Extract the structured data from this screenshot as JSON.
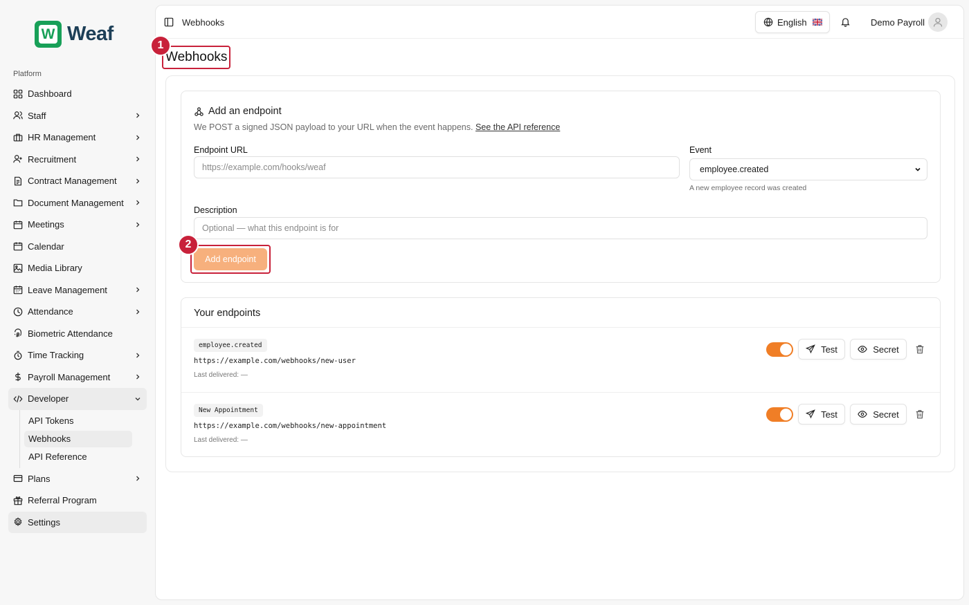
{
  "brand": {
    "name": "Weaf",
    "badge_letter": "W",
    "color": "#18a058"
  },
  "sidebar": {
    "section_label": "Platform",
    "items": [
      {
        "label": "Dashboard",
        "icon": "dashboard-icon",
        "chevron": false
      },
      {
        "label": "Staff",
        "icon": "users-icon",
        "chevron": true
      },
      {
        "label": "HR Management",
        "icon": "briefcase-icon",
        "chevron": true
      },
      {
        "label": "Recruitment",
        "icon": "user-plus-icon",
        "chevron": true
      },
      {
        "label": "Contract Management",
        "icon": "document-icon",
        "chevron": true
      },
      {
        "label": "Document Management",
        "icon": "folder-icon",
        "chevron": true
      },
      {
        "label": "Meetings",
        "icon": "calendar-icon",
        "chevron": true
      },
      {
        "label": "Calendar",
        "icon": "calendar-icon",
        "chevron": false
      },
      {
        "label": "Media Library",
        "icon": "image-icon",
        "chevron": false
      },
      {
        "label": "Leave Management",
        "icon": "calendar-days-icon",
        "chevron": true
      },
      {
        "label": "Attendance",
        "icon": "clock-icon",
        "chevron": true
      },
      {
        "label": "Biometric Attendance",
        "icon": "fingerprint-icon",
        "chevron": false
      },
      {
        "label": "Time Tracking",
        "icon": "timer-icon",
        "chevron": true
      },
      {
        "label": "Payroll Management",
        "icon": "dollar-icon",
        "chevron": true
      },
      {
        "label": "Developer",
        "icon": "code-icon",
        "chevron": true,
        "expanded": true
      }
    ],
    "developer_sub": [
      "API Tokens",
      "Webhooks",
      "API Reference"
    ],
    "bottom_items": [
      {
        "label": "Plans",
        "icon": "credit-card-icon",
        "chevron": true
      },
      {
        "label": "Referral Program",
        "icon": "gift-icon",
        "chevron": false
      },
      {
        "label": "Settings",
        "icon": "gear-icon",
        "chevron": false
      }
    ]
  },
  "topbar": {
    "breadcrumb": "Webhooks",
    "language": "English",
    "user_name": "Demo Payroll"
  },
  "page": {
    "title": "Webhooks"
  },
  "markers": {
    "one": "1",
    "two": "2"
  },
  "add_endpoint": {
    "heading": "Add an endpoint",
    "subtitle": "We POST a signed JSON payload to your URL when the event happens.",
    "api_link": "See the API reference",
    "url_label": "Endpoint URL",
    "url_placeholder": "https://example.com/hooks/weaf",
    "event_label": "Event",
    "event_value": "employee.created",
    "event_hint": "A new employee record was created",
    "description_label": "Description",
    "description_placeholder": "Optional — what this endpoint is for",
    "button_label": "Add endpoint"
  },
  "endpoints": {
    "heading": "Your endpoints",
    "test_label": "Test",
    "secret_label": "Secret",
    "list": [
      {
        "event": "employee.created",
        "url": "https://example.com/webhooks/new-user",
        "last_delivered": "Last delivered: —",
        "enabled": true
      },
      {
        "event": "New Appointment",
        "url": "https://example.com/webhooks/new-appointment",
        "last_delivered": "Last delivered: —",
        "enabled": true
      }
    ]
  },
  "colors": {
    "accent": "#f07e26",
    "highlight": "#c8213a",
    "button_disabled": "#f7b07d"
  }
}
